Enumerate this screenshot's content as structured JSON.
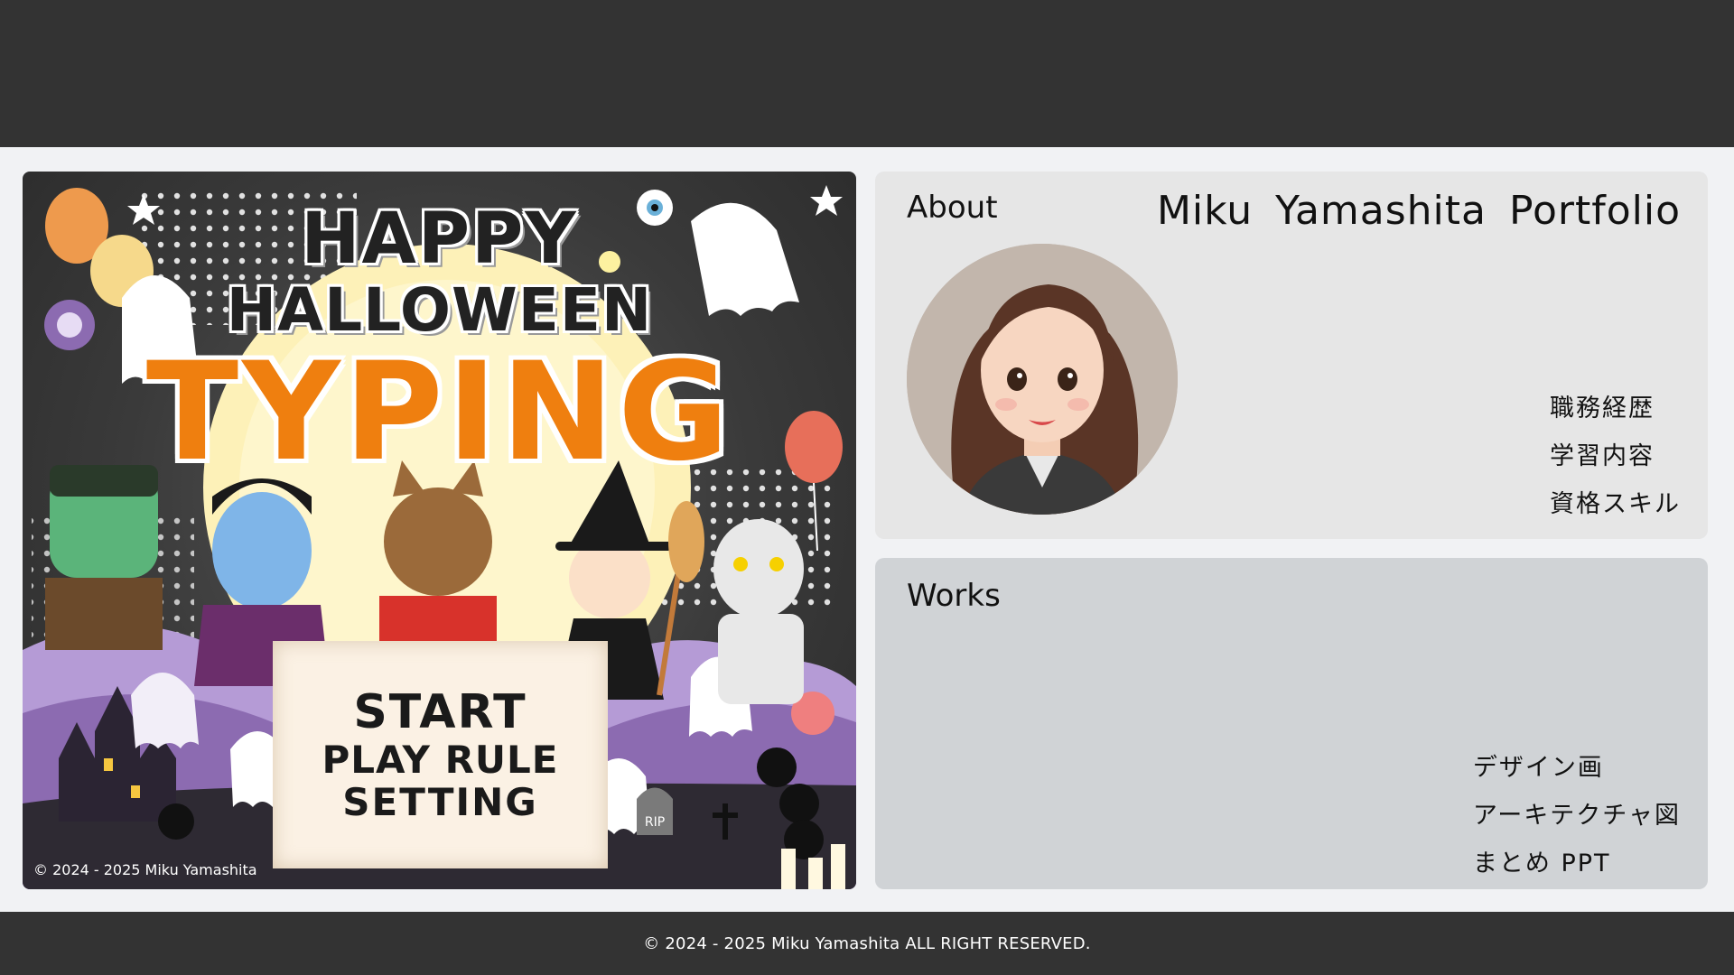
{
  "game": {
    "title_line1": "HAPPY",
    "title_line2": "HALLOWEEN",
    "title_line3": "TYPING",
    "menu": {
      "start": "START",
      "play_rule": "PLAY RULE",
      "setting": "SETTING"
    },
    "copyright": "© 2024 - 2025 Miku Yamashita",
    "tombstone_text": "RIP"
  },
  "about": {
    "heading": "About",
    "portfolio_title": "Miku  Yamashita  Portfolio",
    "links": [
      "職務経歴",
      "学習内容",
      "資格スキル"
    ]
  },
  "works": {
    "heading": "Works",
    "links": [
      "デザイン画",
      "アーキテクチャ図",
      "まとめ PPT"
    ]
  },
  "footer": {
    "copyright": "© 2024 - 2025 Miku Yamashita ALL RIGHT RESERVED."
  },
  "colors": {
    "header_bg": "#333333",
    "page_bg": "#f1f2f4",
    "about_bg": "#e6e6e6",
    "works_bg": "#d0d3d6",
    "typing_orange": "#ef7f0f",
    "purple_hills": "#8c6bb1"
  }
}
